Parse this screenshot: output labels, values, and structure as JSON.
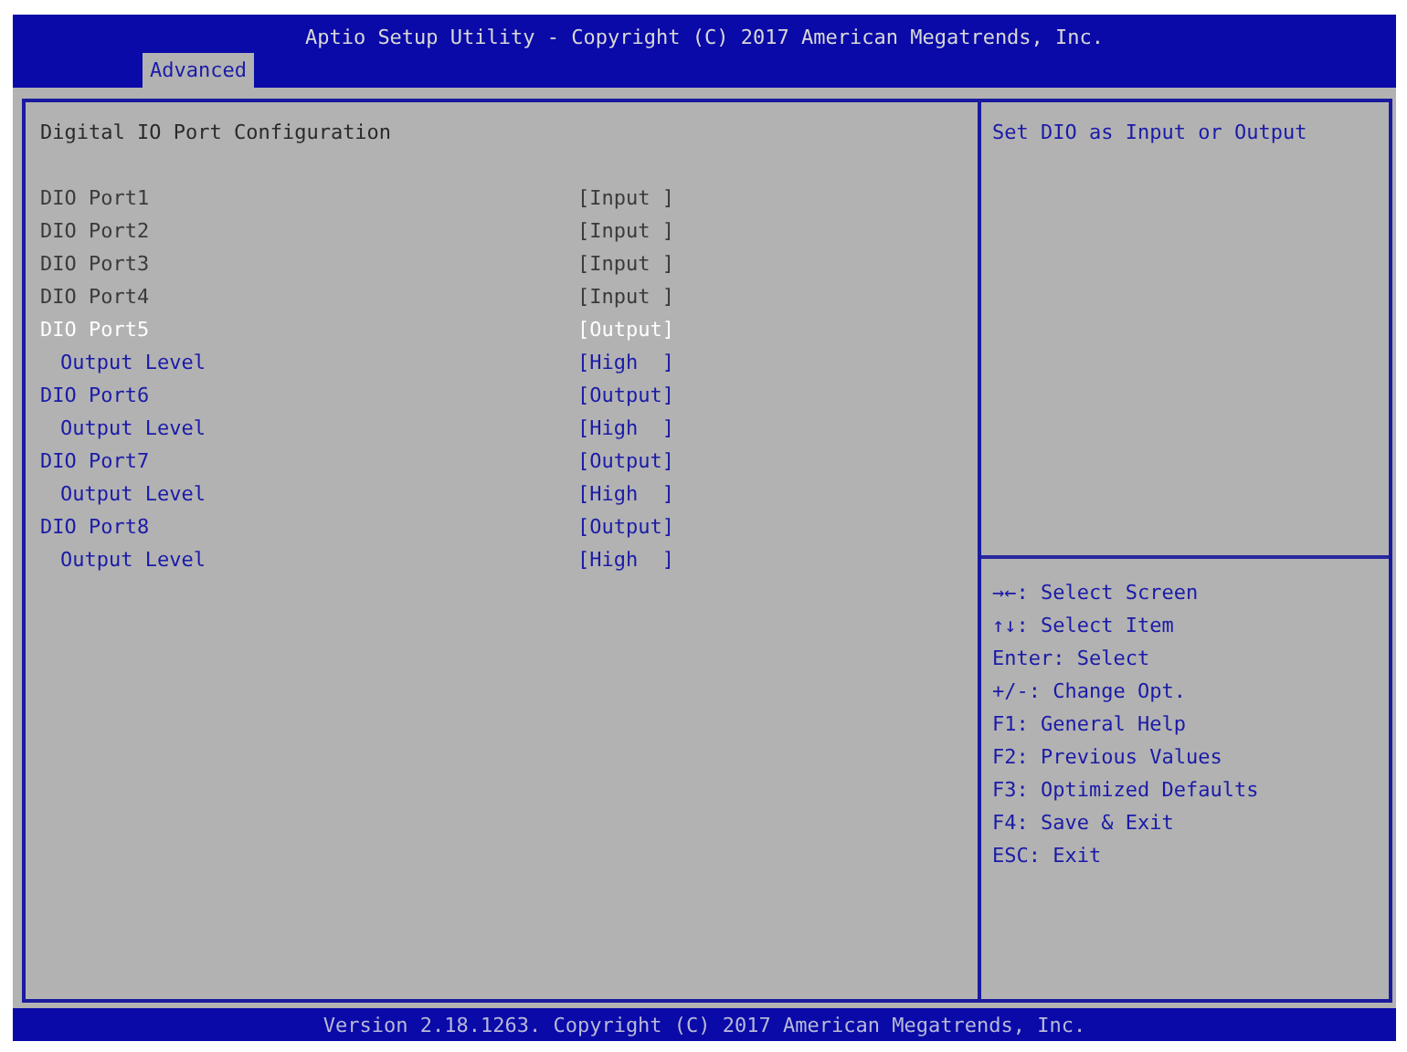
{
  "header": {
    "title": "Aptio Setup Utility - Copyright (C) 2017 American Megatrends, Inc.",
    "tabs": [
      {
        "label": "Advanced",
        "selected": true
      }
    ]
  },
  "page": {
    "title": "Digital IO Port Configuration",
    "items": [
      {
        "label": "DIO Port1",
        "value": "[Input ]",
        "disabled": true,
        "selected": false
      },
      {
        "label": "DIO Port2",
        "value": "[Input ]",
        "disabled": true,
        "selected": false
      },
      {
        "label": "DIO Port3",
        "value": "[Input ]",
        "disabled": true,
        "selected": false
      },
      {
        "label": "DIO Port4",
        "value": "[Input ]",
        "disabled": true,
        "selected": false
      },
      {
        "label": "DIO Port5",
        "value": "[Output]",
        "disabled": false,
        "selected": true,
        "children": [
          {
            "label": "Output Level",
            "value": "[High  ]",
            "disabled": false,
            "selected": false
          }
        ]
      },
      {
        "label": "DIO Port6",
        "value": "[Output]",
        "disabled": false,
        "selected": false,
        "children": [
          {
            "label": "Output Level",
            "value": "[High  ]",
            "disabled": false,
            "selected": false
          }
        ]
      },
      {
        "label": "DIO Port7",
        "value": "[Output]",
        "disabled": false,
        "selected": false,
        "children": [
          {
            "label": "Output Level",
            "value": "[High  ]",
            "disabled": false,
            "selected": false
          }
        ]
      },
      {
        "label": "DIO Port8",
        "value": "[Output]",
        "disabled": false,
        "selected": false,
        "children": [
          {
            "label": "Output Level",
            "value": "[High  ]",
            "disabled": false,
            "selected": false
          }
        ]
      }
    ]
  },
  "help": {
    "text": "Set DIO as Input or Output",
    "keys": [
      "→←: Select Screen",
      "↑↓: Select Item",
      "Enter: Select",
      "+/-: Change Opt.",
      "F1: General Help",
      "F2: Previous Values",
      "F3: Optimized Defaults",
      "F4: Save & Exit",
      "ESC: Exit"
    ]
  },
  "footer": "Version 2.18.1263. Copyright (C) 2017 American Megatrends, Inc."
}
